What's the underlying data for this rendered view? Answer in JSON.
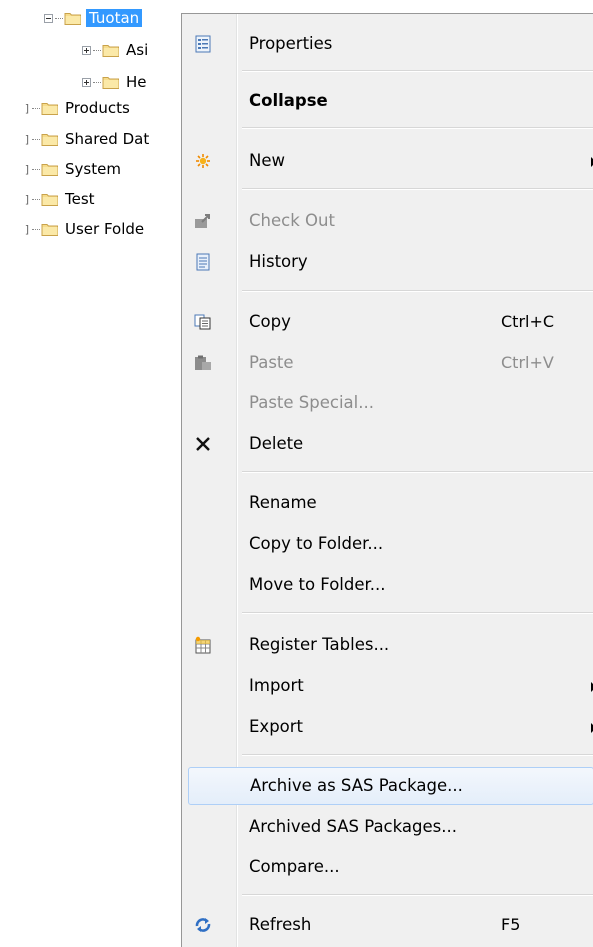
{
  "tree": {
    "selected": "Tuotan",
    "children": [
      "Asi",
      "He"
    ],
    "items": [
      "Products",
      "Shared Dat",
      "System",
      "Test",
      "User Folde"
    ]
  },
  "menu": {
    "properties": "Properties",
    "collapse": "Collapse",
    "new": "New",
    "check_out": "Check Out",
    "history": "History",
    "copy": "Copy",
    "copy_shortcut": "Ctrl+C",
    "paste": "Paste",
    "paste_shortcut": "Ctrl+V",
    "paste_special": "Paste Special...",
    "delete": "Delete",
    "rename": "Rename",
    "copy_to_folder": "Copy to Folder...",
    "move_to_folder": "Move to Folder...",
    "register_tables": "Register Tables...",
    "import": "Import",
    "export": "Export",
    "archive_as_sas_package": "Archive as SAS Package...",
    "archived_sas_packages": "Archived SAS Packages...",
    "compare": "Compare...",
    "refresh": "Refresh",
    "refresh_shortcut": "F5"
  },
  "colors": {
    "selection": "#3399ff",
    "highlight_border": "#aecff7",
    "folder": "#f5d77e"
  }
}
